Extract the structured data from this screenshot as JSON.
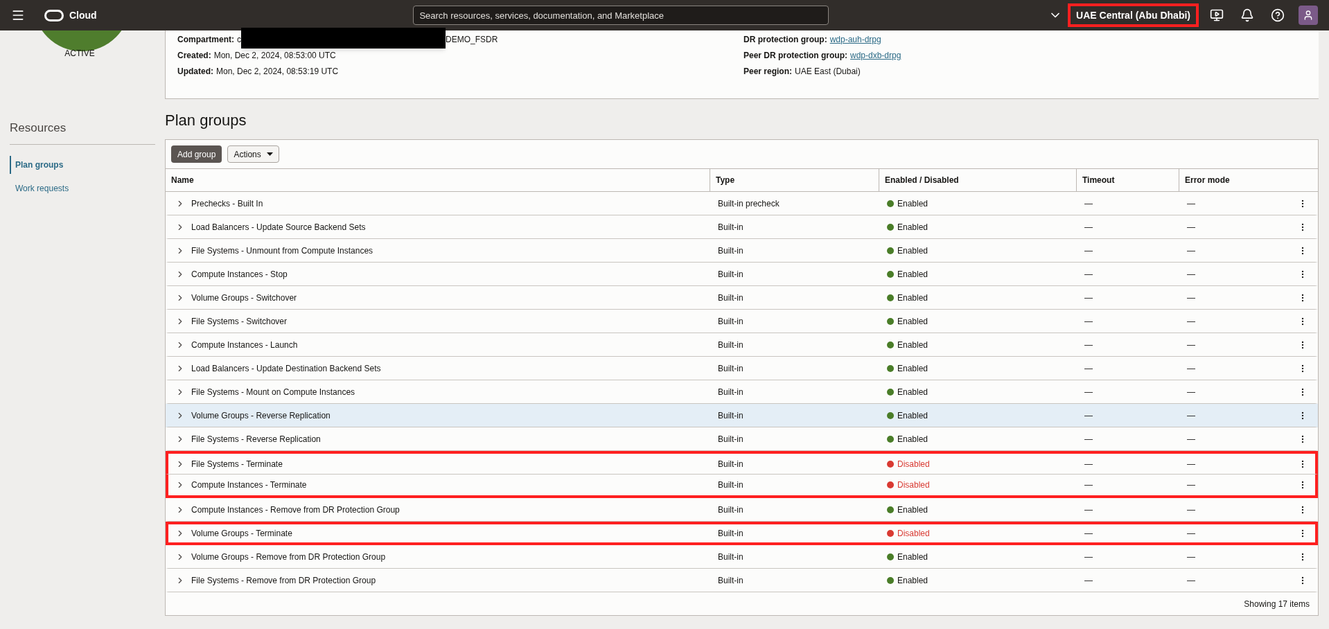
{
  "top_bar": {
    "brand": "Cloud",
    "search": {
      "placeholder": "Search resources, services, documentation, and Marketplace"
    },
    "region": {
      "label": "UAE Central (Abu Dhabi)",
      "highlighted": true
    }
  },
  "status": {
    "label": "ACTIVE"
  },
  "details": {
    "left": [
      {
        "label": "Compartment:",
        "value_start": "c",
        "redacted": true,
        "value_end": "DEMO_FSDR"
      },
      {
        "label": "Created:",
        "value_start": "Mon, Dec 2, 2024, 08:53:00 UTC",
        "redacted": false
      },
      {
        "label": "Updated:",
        "value_start": "Mon, Dec 2, 2024, 08:53:19 UTC",
        "redacted": false
      }
    ],
    "right": [
      {
        "label": "DR protection group:",
        "value": "wdp-auh-drpg",
        "link": true
      },
      {
        "label": "Peer DR protection group:",
        "value": "wdp-dxb-drpg",
        "link": true
      },
      {
        "label": "Peer region:",
        "value": "UAE East (Dubai)",
        "link": false
      }
    ]
  },
  "sidebar": {
    "title": "Resources",
    "items": [
      {
        "label": "Plan groups",
        "selected": true
      },
      {
        "label": "Work requests",
        "selected": false
      }
    ]
  },
  "plan_groups": {
    "title": "Plan groups",
    "buttons": [
      {
        "label": "Add group",
        "kind": "primary"
      },
      {
        "label": "Actions",
        "kind": "menu"
      }
    ],
    "columns": [
      "Name",
      "Type",
      "Enabled / Disabled",
      "Timeout",
      "Error mode"
    ],
    "rows": [
      {
        "name": "Prechecks - Built In",
        "type": "Built-in precheck",
        "enabled": true,
        "status": "Enabled",
        "timeout": "—",
        "error_mode": "—",
        "hovered": false,
        "highlighted": false
      },
      {
        "name": "Load Balancers - Update Source Backend Sets",
        "type": "Built-in",
        "enabled": true,
        "status": "Enabled",
        "timeout": "—",
        "error_mode": "—",
        "hovered": false,
        "highlighted": false
      },
      {
        "name": "File Systems - Unmount from Compute Instances",
        "type": "Built-in",
        "enabled": true,
        "status": "Enabled",
        "timeout": "—",
        "error_mode": "—",
        "hovered": false,
        "highlighted": false
      },
      {
        "name": "Compute Instances - Stop",
        "type": "Built-in",
        "enabled": true,
        "status": "Enabled",
        "timeout": "—",
        "error_mode": "—",
        "hovered": false,
        "highlighted": false
      },
      {
        "name": "Volume Groups - Switchover",
        "type": "Built-in",
        "enabled": true,
        "status": "Enabled",
        "timeout": "—",
        "error_mode": "—",
        "hovered": false,
        "highlighted": false
      },
      {
        "name": "File Systems - Switchover",
        "type": "Built-in",
        "enabled": true,
        "status": "Enabled",
        "timeout": "—",
        "error_mode": "—",
        "hovered": false,
        "highlighted": false
      },
      {
        "name": "Compute Instances - Launch",
        "type": "Built-in",
        "enabled": true,
        "status": "Enabled",
        "timeout": "—",
        "error_mode": "—",
        "hovered": false,
        "highlighted": false
      },
      {
        "name": "Load Balancers - Update Destination Backend Sets",
        "type": "Built-in",
        "enabled": true,
        "status": "Enabled",
        "timeout": "—",
        "error_mode": "—",
        "hovered": false,
        "highlighted": false
      },
      {
        "name": "File Systems - Mount on Compute Instances",
        "type": "Built-in",
        "enabled": true,
        "status": "Enabled",
        "timeout": "—",
        "error_mode": "—",
        "hovered": false,
        "highlighted": false
      },
      {
        "name": "Volume Groups - Reverse Replication",
        "type": "Built-in",
        "enabled": true,
        "status": "Enabled",
        "timeout": "—",
        "error_mode": "—",
        "hovered": true,
        "highlighted": false
      },
      {
        "name": "File Systems - Reverse Replication",
        "type": "Built-in",
        "enabled": true,
        "status": "Enabled",
        "timeout": "—",
        "error_mode": "—",
        "hovered": false,
        "highlighted": false
      },
      {
        "name": "File Systems - Terminate",
        "type": "Built-in",
        "enabled": false,
        "status": "Disabled",
        "timeout": "—",
        "error_mode": "—",
        "hovered": false,
        "highlighted": true
      },
      {
        "name": "Compute Instances - Terminate",
        "type": "Built-in",
        "enabled": false,
        "status": "Disabled",
        "timeout": "—",
        "error_mode": "—",
        "hovered": false,
        "highlighted": true
      },
      {
        "name": "Compute Instances - Remove from DR Protection Group",
        "type": "Built-in",
        "enabled": true,
        "status": "Enabled",
        "timeout": "—",
        "error_mode": "—",
        "hovered": false,
        "highlighted": false
      },
      {
        "name": "Volume Groups - Terminate",
        "type": "Built-in",
        "enabled": false,
        "status": "Disabled",
        "timeout": "—",
        "error_mode": "—",
        "hovered": false,
        "highlighted": true
      },
      {
        "name": "Volume Groups - Remove from DR Protection Group",
        "type": "Built-in",
        "enabled": true,
        "status": "Enabled",
        "timeout": "—",
        "error_mode": "—",
        "hovered": false,
        "highlighted": false
      },
      {
        "name": "File Systems - Remove from DR Protection Group",
        "type": "Built-in",
        "enabled": true,
        "status": "Enabled",
        "timeout": "—",
        "error_mode": "—",
        "hovered": false,
        "highlighted": false
      }
    ],
    "footer": "Showing 17 items"
  }
}
